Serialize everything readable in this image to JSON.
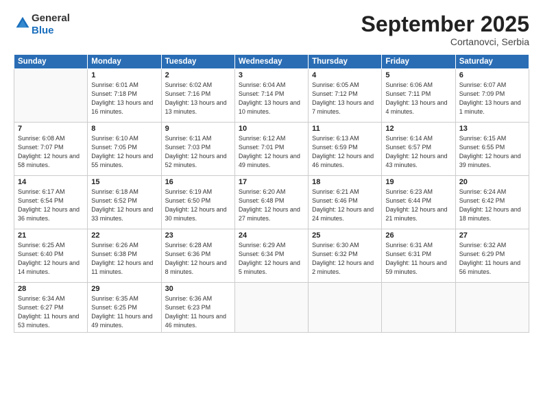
{
  "logo": {
    "general": "General",
    "blue": "Blue"
  },
  "header": {
    "title": "September 2025",
    "location": "Cortanovci, Serbia"
  },
  "weekdays": [
    "Sunday",
    "Monday",
    "Tuesday",
    "Wednesday",
    "Thursday",
    "Friday",
    "Saturday"
  ],
  "weeks": [
    [
      {
        "day": "",
        "sunrise": "",
        "sunset": "",
        "daylight": ""
      },
      {
        "day": "1",
        "sunrise": "Sunrise: 6:01 AM",
        "sunset": "Sunset: 7:18 PM",
        "daylight": "Daylight: 13 hours and 16 minutes."
      },
      {
        "day": "2",
        "sunrise": "Sunrise: 6:02 AM",
        "sunset": "Sunset: 7:16 PM",
        "daylight": "Daylight: 13 hours and 13 minutes."
      },
      {
        "day": "3",
        "sunrise": "Sunrise: 6:04 AM",
        "sunset": "Sunset: 7:14 PM",
        "daylight": "Daylight: 13 hours and 10 minutes."
      },
      {
        "day": "4",
        "sunrise": "Sunrise: 6:05 AM",
        "sunset": "Sunset: 7:12 PM",
        "daylight": "Daylight: 13 hours and 7 minutes."
      },
      {
        "day": "5",
        "sunrise": "Sunrise: 6:06 AM",
        "sunset": "Sunset: 7:11 PM",
        "daylight": "Daylight: 13 hours and 4 minutes."
      },
      {
        "day": "6",
        "sunrise": "Sunrise: 6:07 AM",
        "sunset": "Sunset: 7:09 PM",
        "daylight": "Daylight: 13 hours and 1 minute."
      }
    ],
    [
      {
        "day": "7",
        "sunrise": "Sunrise: 6:08 AM",
        "sunset": "Sunset: 7:07 PM",
        "daylight": "Daylight: 12 hours and 58 minutes."
      },
      {
        "day": "8",
        "sunrise": "Sunrise: 6:10 AM",
        "sunset": "Sunset: 7:05 PM",
        "daylight": "Daylight: 12 hours and 55 minutes."
      },
      {
        "day": "9",
        "sunrise": "Sunrise: 6:11 AM",
        "sunset": "Sunset: 7:03 PM",
        "daylight": "Daylight: 12 hours and 52 minutes."
      },
      {
        "day": "10",
        "sunrise": "Sunrise: 6:12 AM",
        "sunset": "Sunset: 7:01 PM",
        "daylight": "Daylight: 12 hours and 49 minutes."
      },
      {
        "day": "11",
        "sunrise": "Sunrise: 6:13 AM",
        "sunset": "Sunset: 6:59 PM",
        "daylight": "Daylight: 12 hours and 46 minutes."
      },
      {
        "day": "12",
        "sunrise": "Sunrise: 6:14 AM",
        "sunset": "Sunset: 6:57 PM",
        "daylight": "Daylight: 12 hours and 43 minutes."
      },
      {
        "day": "13",
        "sunrise": "Sunrise: 6:15 AM",
        "sunset": "Sunset: 6:55 PM",
        "daylight": "Daylight: 12 hours and 39 minutes."
      }
    ],
    [
      {
        "day": "14",
        "sunrise": "Sunrise: 6:17 AM",
        "sunset": "Sunset: 6:54 PM",
        "daylight": "Daylight: 12 hours and 36 minutes."
      },
      {
        "day": "15",
        "sunrise": "Sunrise: 6:18 AM",
        "sunset": "Sunset: 6:52 PM",
        "daylight": "Daylight: 12 hours and 33 minutes."
      },
      {
        "day": "16",
        "sunrise": "Sunrise: 6:19 AM",
        "sunset": "Sunset: 6:50 PM",
        "daylight": "Daylight: 12 hours and 30 minutes."
      },
      {
        "day": "17",
        "sunrise": "Sunrise: 6:20 AM",
        "sunset": "Sunset: 6:48 PM",
        "daylight": "Daylight: 12 hours and 27 minutes."
      },
      {
        "day": "18",
        "sunrise": "Sunrise: 6:21 AM",
        "sunset": "Sunset: 6:46 PM",
        "daylight": "Daylight: 12 hours and 24 minutes."
      },
      {
        "day": "19",
        "sunrise": "Sunrise: 6:23 AM",
        "sunset": "Sunset: 6:44 PM",
        "daylight": "Daylight: 12 hours and 21 minutes."
      },
      {
        "day": "20",
        "sunrise": "Sunrise: 6:24 AM",
        "sunset": "Sunset: 6:42 PM",
        "daylight": "Daylight: 12 hours and 18 minutes."
      }
    ],
    [
      {
        "day": "21",
        "sunrise": "Sunrise: 6:25 AM",
        "sunset": "Sunset: 6:40 PM",
        "daylight": "Daylight: 12 hours and 14 minutes."
      },
      {
        "day": "22",
        "sunrise": "Sunrise: 6:26 AM",
        "sunset": "Sunset: 6:38 PM",
        "daylight": "Daylight: 12 hours and 11 minutes."
      },
      {
        "day": "23",
        "sunrise": "Sunrise: 6:28 AM",
        "sunset": "Sunset: 6:36 PM",
        "daylight": "Daylight: 12 hours and 8 minutes."
      },
      {
        "day": "24",
        "sunrise": "Sunrise: 6:29 AM",
        "sunset": "Sunset: 6:34 PM",
        "daylight": "Daylight: 12 hours and 5 minutes."
      },
      {
        "day": "25",
        "sunrise": "Sunrise: 6:30 AM",
        "sunset": "Sunset: 6:32 PM",
        "daylight": "Daylight: 12 hours and 2 minutes."
      },
      {
        "day": "26",
        "sunrise": "Sunrise: 6:31 AM",
        "sunset": "Sunset: 6:31 PM",
        "daylight": "Daylight: 11 hours and 59 minutes."
      },
      {
        "day": "27",
        "sunrise": "Sunrise: 6:32 AM",
        "sunset": "Sunset: 6:29 PM",
        "daylight": "Daylight: 11 hours and 56 minutes."
      }
    ],
    [
      {
        "day": "28",
        "sunrise": "Sunrise: 6:34 AM",
        "sunset": "Sunset: 6:27 PM",
        "daylight": "Daylight: 11 hours and 53 minutes."
      },
      {
        "day": "29",
        "sunrise": "Sunrise: 6:35 AM",
        "sunset": "Sunset: 6:25 PM",
        "daylight": "Daylight: 11 hours and 49 minutes."
      },
      {
        "day": "30",
        "sunrise": "Sunrise: 6:36 AM",
        "sunset": "Sunset: 6:23 PM",
        "daylight": "Daylight: 11 hours and 46 minutes."
      },
      {
        "day": "",
        "sunrise": "",
        "sunset": "",
        "daylight": ""
      },
      {
        "day": "",
        "sunrise": "",
        "sunset": "",
        "daylight": ""
      },
      {
        "day": "",
        "sunrise": "",
        "sunset": "",
        "daylight": ""
      },
      {
        "day": "",
        "sunrise": "",
        "sunset": "",
        "daylight": ""
      }
    ]
  ]
}
